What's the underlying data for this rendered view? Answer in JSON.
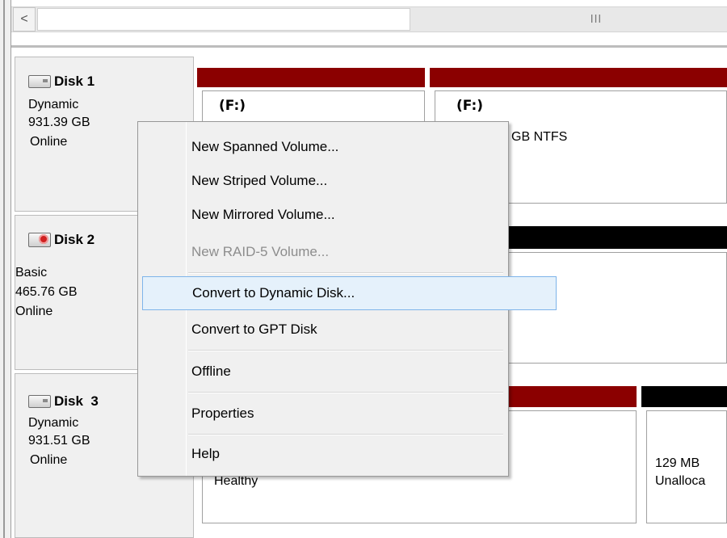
{
  "scrollbar": {
    "left_arrow": "<",
    "grip": "III"
  },
  "disks": [
    {
      "name": "Disk 1",
      "type": "Dynamic",
      "size": "931.39 GB",
      "status": "Online",
      "icon": "hard-disk-icon"
    },
    {
      "name": "Disk 2",
      "type": "Basic",
      "size": "465.76 GB",
      "status": "Online",
      "icon": "hard-disk-removable-icon"
    },
    {
      "name": "Disk  3",
      "type": "Dynamic",
      "size": "931.51 GB",
      "status": "Online",
      "icon": "hard-disk-icon"
    }
  ],
  "volumes": {
    "disk1_vol1_title": "(F:)",
    "disk1_vol2_title": "(F:)",
    "disk1_vol2_info": "GB NTFS",
    "disk3_vol1_status": "Healthy",
    "disk3_vol2_size": "129 MB",
    "disk3_vol2_status": "Unalloca"
  },
  "context_menu": {
    "items": [
      {
        "label": "New Spanned Volume...",
        "enabled": true
      },
      {
        "label": "New Striped Volume...",
        "enabled": true
      },
      {
        "label": "New Mirrored Volume...",
        "enabled": true
      },
      {
        "label": "New RAID-5 Volume...",
        "enabled": false
      },
      {
        "label": "Convert to Dynamic Disk...",
        "enabled": true,
        "highlighted": true
      },
      {
        "label": "Convert to GPT Disk",
        "enabled": true
      },
      {
        "label": "Offline",
        "enabled": true
      },
      {
        "label": "Properties",
        "enabled": true
      },
      {
        "label": "Help",
        "enabled": true
      }
    ]
  },
  "colors": {
    "volume_bar_dynamic": "#8b0000",
    "volume_bar_unallocated": "#000000",
    "menu_highlight": "#e5f1fb",
    "menu_highlight_border": "#7eb4ea"
  }
}
